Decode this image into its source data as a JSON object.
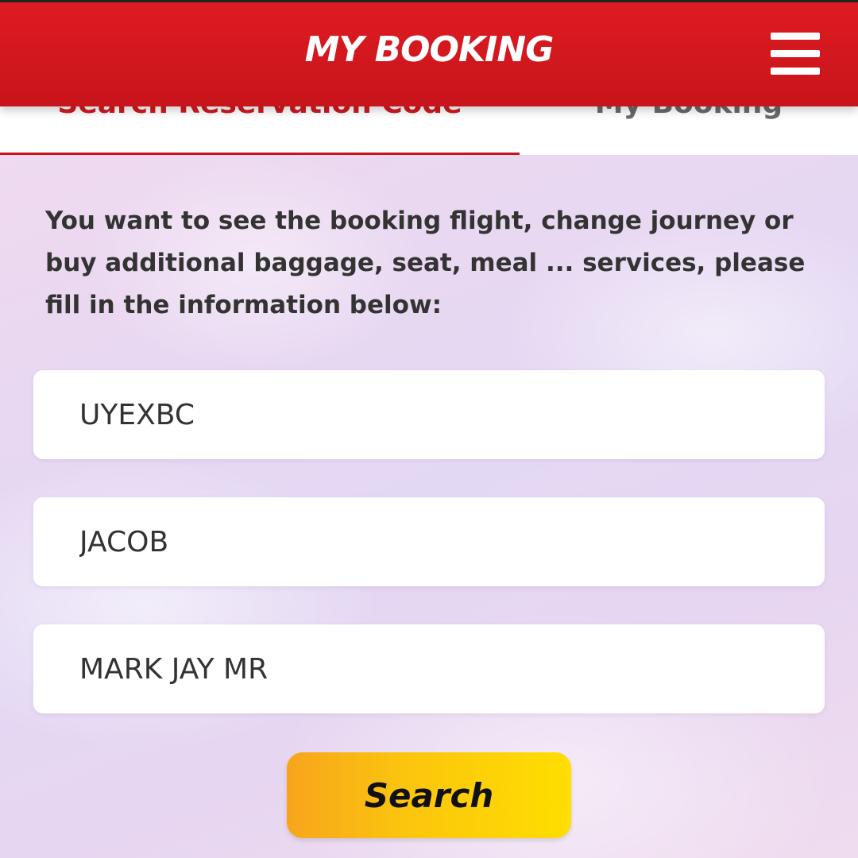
{
  "header": {
    "title": "MY BOOKING",
    "menu_icon": "hamburger-menu-icon"
  },
  "tabs": [
    {
      "label": "Search Reservation Code",
      "active": true
    },
    {
      "label": "My Booking",
      "active": false
    }
  ],
  "intro_text": "You want to see the booking flight, change journey or buy additional baggage, seat, meal ... services, please fill in the information below:",
  "form": {
    "reservation_code": "UYEXBC",
    "first_name": "JACOB",
    "last_name": "MARK JAY MR"
  },
  "search_button_label": "Search",
  "colors": {
    "brand_red": "#d21a20",
    "button_yellow": "#fbc40e"
  }
}
